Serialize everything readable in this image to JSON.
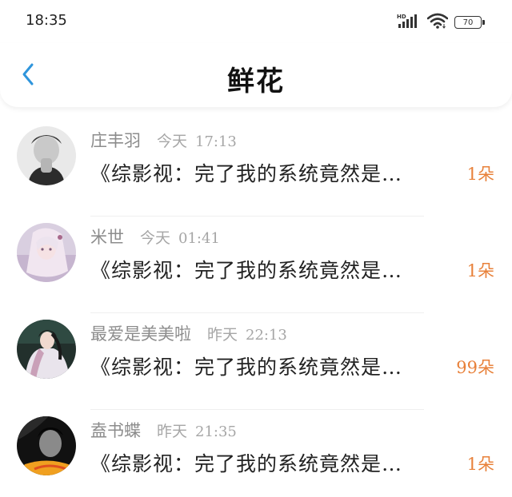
{
  "status_bar": {
    "time": "18:35",
    "signal_label": "HD",
    "battery": "70",
    "icons": [
      "signal-icon",
      "wifi-icon",
      "battery-icon"
    ]
  },
  "header": {
    "back_icon": "chevron-left-icon",
    "title": "鲜花"
  },
  "colors": {
    "accent_blue": "#2f95dc",
    "count_orange": "#e8813a",
    "meta_gray": "#a6a6a6"
  },
  "items": [
    {
      "name": "庄丰羽",
      "day": "今天",
      "time": "17:13",
      "book": "《综影视：完了我的系统竟然是…",
      "count": "1朵",
      "avatar": "grayscale-portrait-avatar"
    },
    {
      "name": "米世",
      "day": "今天",
      "time": "01:41",
      "book": "《综影视：完了我的系统竟然是…",
      "count": "1朵",
      "avatar": "anime-girl-avatar"
    },
    {
      "name": "最爱是美美啦",
      "day": "昨天",
      "time": "22:13",
      "book": "《综影视：完了我的系统竟然是…",
      "count": "99朵",
      "avatar": "costume-portrait-avatar"
    },
    {
      "name": "盍书蝶",
      "day": "昨天",
      "time": "21:35",
      "book": "《综影视：完了我的系统竟然是…",
      "count": "1朵",
      "avatar": "dark-portrait-avatar"
    }
  ]
}
